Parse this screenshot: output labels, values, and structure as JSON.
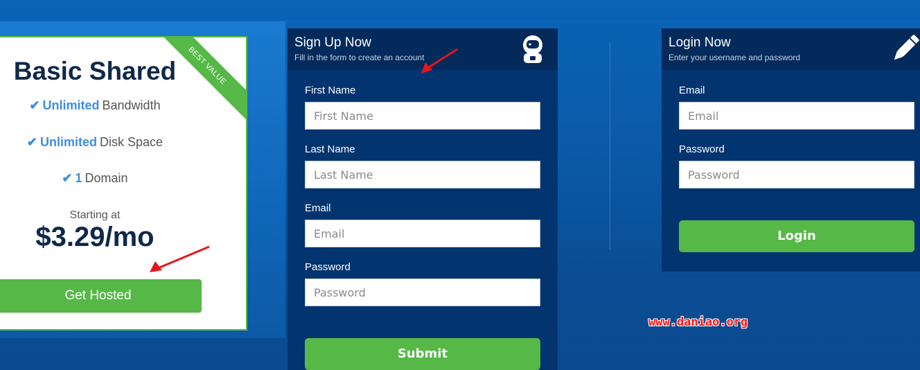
{
  "pricing": {
    "ribbon": "BEST VALUE",
    "title": "Basic Shared",
    "features": [
      {
        "highlight": "Unlimited",
        "text": "Bandwidth"
      },
      {
        "highlight": "Unlimited",
        "text": "Disk Space"
      },
      {
        "highlight": "1",
        "text": "Domain"
      }
    ],
    "starting_label": "Starting at",
    "price": "$3.29/mo",
    "button_label": "Get Hosted"
  },
  "signup": {
    "title": "Sign Up Now",
    "subtitle": "Fill in the form to create an account",
    "icon": "astronaut-icon",
    "fields": [
      {
        "label": "First Name",
        "placeholder": "First Name",
        "value": ""
      },
      {
        "label": "Last Name",
        "placeholder": "Last Name",
        "value": ""
      },
      {
        "label": "Email",
        "placeholder": "Email",
        "value": ""
      },
      {
        "label": "Password",
        "placeholder": "Password",
        "value": ""
      }
    ],
    "submit_label": "Submit"
  },
  "login": {
    "title": "Login Now",
    "subtitle": "Enter your username and password",
    "icon": "pencil-icon",
    "fields": [
      {
        "label": "Email",
        "placeholder": "Email",
        "value": ""
      },
      {
        "label": "Password",
        "placeholder": "Password",
        "value": ""
      }
    ],
    "login_label": "Login"
  },
  "watermark": "www.daniao.org",
  "colors": {
    "accent_green": "#56b847",
    "panel_blue": "#023470",
    "background_blue": "#0a5aa8",
    "price_text": "#10294a",
    "highlight_blue": "#3d8ede",
    "annotation_red": "#e5161b"
  }
}
